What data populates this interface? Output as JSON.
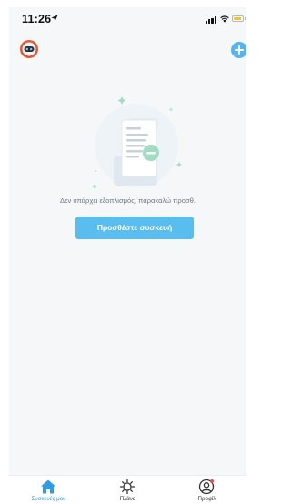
{
  "status_bar": {
    "time": "11:26"
  },
  "header": {
    "avatar_icon": "robot-avatar-icon",
    "add_icon": "plus-icon"
  },
  "empty_state": {
    "illustration": "empty-document-illustration",
    "message": "Δεν υπάρχει εξοπλισμός, παρακαλώ προσθ.",
    "button_label": "Προσθέστε συσκευή"
  },
  "tabs": [
    {
      "label": "Συσκευές μου",
      "icon": "home-icon",
      "active": true
    },
    {
      "label": "Πλάνα",
      "icon": "sun-icon",
      "active": false
    },
    {
      "label": "Προφίλ",
      "icon": "profile-icon",
      "active": false
    }
  ],
  "colors": {
    "accent": "#59bdf0",
    "active_tab": "#2f9ae8",
    "background": "#f6f7f9"
  }
}
